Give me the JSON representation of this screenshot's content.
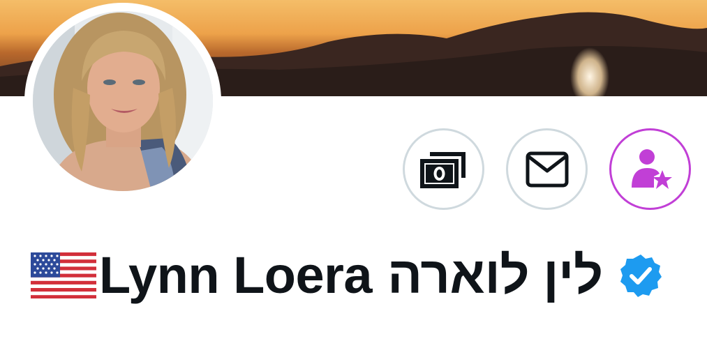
{
  "profile": {
    "name_latin": "Lynn Loera",
    "name_hebrew": "לין לוארה",
    "flag_icon": "us-flag-icon",
    "verified_icon": "verified-badge-icon",
    "verified_color": "#1d9bf0"
  },
  "actions": [
    {
      "id": "tip",
      "icon": "money-icon"
    },
    {
      "id": "message",
      "icon": "envelope-icon"
    },
    {
      "id": "subscribe",
      "icon": "person-star-icon",
      "color": "#c13fd6"
    }
  ],
  "colors": {
    "subscribe_accent": "#c13fd6",
    "button_border": "#cfd9de",
    "text": "#0f1419"
  }
}
